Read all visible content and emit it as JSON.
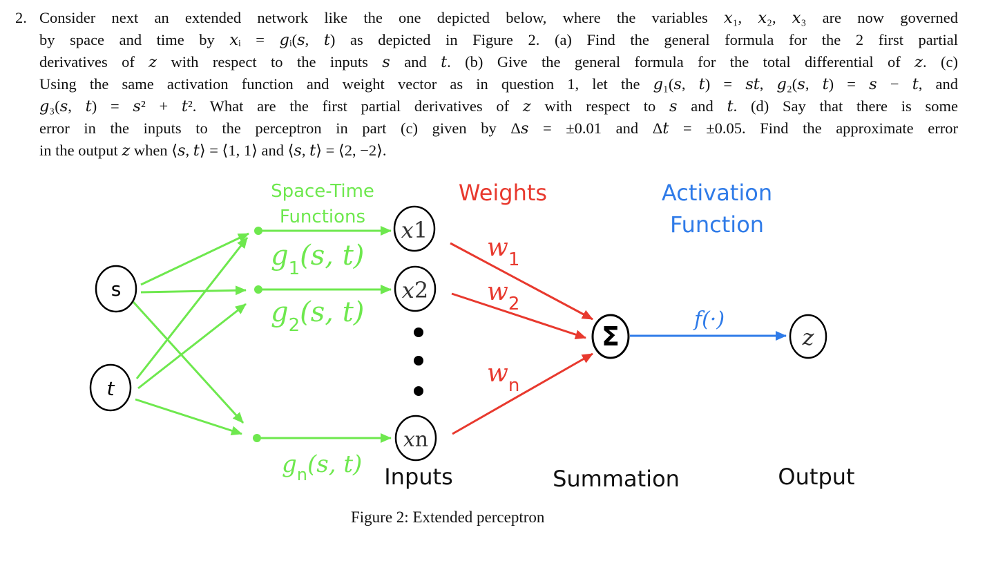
{
  "problem": {
    "number": "2.",
    "lines": [
      "Consider next an extended network like the one depicted below, where the variables 𝑥₁, 𝑥₂, 𝑥₃ are now governed",
      "by space and time by 𝑥ᵢ = 𝑔ᵢ(𝑠, 𝑡) as depicted in Figure 2. (a) Find the general formula for the 2 first partial",
      "derivatives of 𝑧 with respect to the inputs 𝑠 and 𝑡. (b) Give the general formula for the total differential of 𝑧. (c)",
      "Using the same activation function and weight vector as in question 1, let the 𝑔₁(𝑠, 𝑡) = 𝑠𝑡, 𝑔₂(𝑠, 𝑡) = 𝑠 − 𝑡, and",
      "𝑔₃(𝑠, 𝑡) = 𝑠² + 𝑡². What are the first partial derivatives of 𝑧 with respect to 𝑠 and 𝑡. (d) Say that there is some",
      "error in the inputs to the perceptron in part (c) given by Δ𝑠 = ±0.01 and Δ𝑡 = ±0.05. Find the approximate error",
      "in the output 𝑧 when ⟨𝑠, 𝑡⟩ = ⟨1, 1⟩ and ⟨𝑠, 𝑡⟩ = ⟨2, −2⟩."
    ]
  },
  "figure": {
    "caption": "Figure 2: Extended perceptron",
    "colors": {
      "green": "#6ee84e",
      "red": "#e8392e",
      "blue": "#2f7be8",
      "black": "#000000"
    },
    "headers": {
      "space_time_1": "Space-Time",
      "space_time_2": "Functions",
      "weights": "Weights",
      "activation_1": "Activation",
      "activation_2": "Function"
    },
    "source_nodes": {
      "s": "s",
      "t": "t"
    },
    "functions": {
      "g1": "g",
      "g1_sub": "1",
      "g2": "g",
      "g2_sub": "2",
      "gn": "g",
      "gn_sub": "n",
      "args": "(s, t)"
    },
    "input_nodes": {
      "x1": "x",
      "x1_sub": "1",
      "x2": "x",
      "x2_sub": "2",
      "xn": "x",
      "xn_sub": "n"
    },
    "weights": {
      "w1": "w",
      "w1_sub": "1",
      "w2": "w",
      "w2_sub": "2",
      "wn": "w",
      "wn_sub": "n"
    },
    "summation_symbol": "Σ",
    "activation_label": "f(·)",
    "output_node": "z",
    "bottom_labels": {
      "inputs": "Inputs",
      "summation": "Summation",
      "output": "Output"
    }
  }
}
